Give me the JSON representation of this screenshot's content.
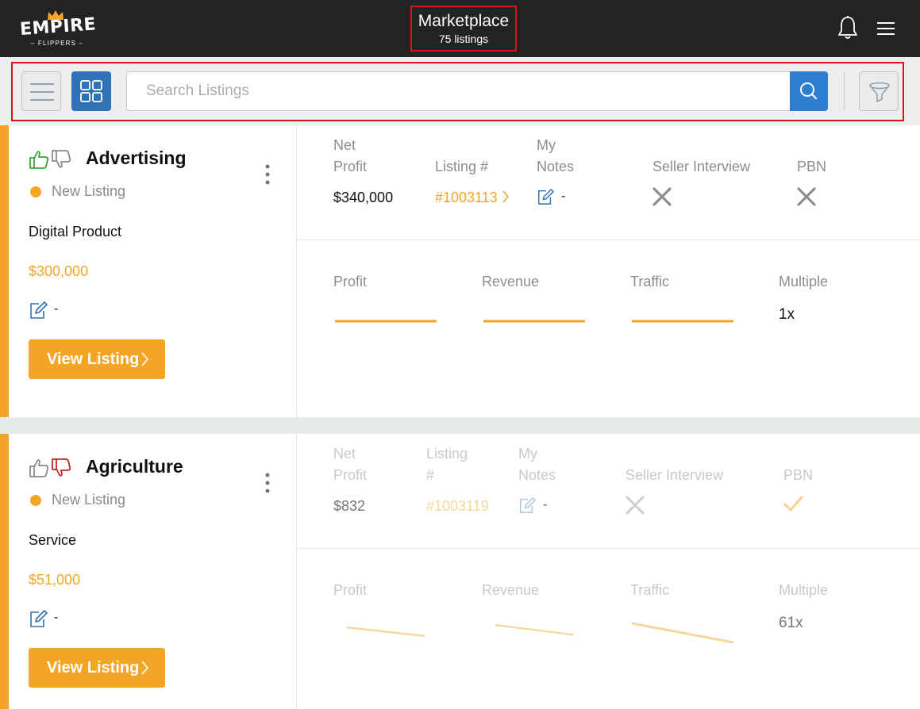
{
  "header": {
    "logo_word": "EMPIRE",
    "logo_sub": "– FLIPPERS –",
    "title": "Marketplace",
    "subtitle": "75 listings"
  },
  "toolbar": {
    "search_placeholder": "Search Listings"
  },
  "colors": {
    "accent": "#f3a626",
    "primary_blue": "#2f72b6",
    "header_bg": "#232323",
    "highlight_border": "#e0101a"
  },
  "columns": {
    "net_profit": "Net\nProfit",
    "listing": "Listing #",
    "listing_wrapped": "Listing\n#",
    "my_notes": "My\nNotes",
    "seller_interview": "Seller Interview",
    "pbn": "PBN",
    "profit": "Profit",
    "revenue": "Revenue",
    "traffic": "Traffic",
    "multiple": "Multiple"
  },
  "listings": [
    {
      "category": "Advertising",
      "status": "New Listing",
      "type": "Digital Product",
      "price": "$300,000",
      "note": "-",
      "view_label": "View Listing",
      "liked": true,
      "disliked": false,
      "net_profit": "$340,000",
      "listing_number": "#1003113",
      "my_notes": "-",
      "seller_interview": "no",
      "pbn": "no",
      "multiple": "1x"
    },
    {
      "category": "Agriculture",
      "status": "New Listing",
      "type": "Service",
      "price": "$51,000",
      "note": "-",
      "view_label": "View Listing",
      "liked": false,
      "disliked": true,
      "net_profit": "$832",
      "listing_number": "#1003119",
      "my_notes": "-",
      "seller_interview": "no",
      "pbn": "yes",
      "multiple": "61x"
    }
  ]
}
